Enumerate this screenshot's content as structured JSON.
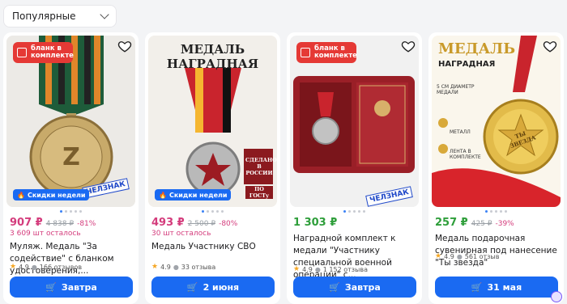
{
  "sort": {
    "label": "Популярные"
  },
  "colors": {
    "accent": "#1a6af2",
    "discount": "#d43c7c",
    "green_price": "#2e9e3a"
  },
  "products": [
    {
      "badge": "бланк в комплекте",
      "week_tag": "Скидки недели",
      "stamp": "ЧЕЛЗНАК",
      "price": "907 ₽",
      "old_price": "4 838 ₽",
      "discount": "-81%",
      "stock": "3 609 шт осталось",
      "title": "Муляж. Медаль \"За содействие\" с бланком удостоверения,...",
      "rating": "4.9",
      "reviews": "166 отзывов",
      "delivery": "Завтра"
    },
    {
      "image_title": "МЕДАЛЬ НАГРАДНАЯ",
      "image_caption": "СДЕЛАНО В РОССИИ",
      "image_caption2": "ПО ГОСТу",
      "week_tag": "Скидки недели",
      "price": "493 ₽",
      "old_price": "2 500 ₽",
      "discount": "-80%",
      "stock": "30 шт осталось",
      "title": "Медаль Участнику СВО",
      "rating": "4.9",
      "reviews": "33 отзыва",
      "delivery": "2 июня"
    },
    {
      "badge": "бланк в комплекте",
      "stamp": "ЧЕЛЗНАК",
      "price": "1 303 ₽",
      "title": "Наградной комплект к медали \"Участнику специальной военной операции\" с...",
      "rating": "4.9",
      "reviews": "1 152 отзыва",
      "delivery": "Завтра"
    },
    {
      "image_title": "МЕДАЛЬ",
      "image_subtitle": "НАГРАДНАЯ",
      "image_feature1": "5 СМ ДИАМЕТР МЕДАЛИ",
      "image_feature2": "МЕТАЛЛ",
      "image_feature3": "ЛЕНТА В КОМПЛЕКТЕ",
      "image_medal_text": "ТЫ ЗВЕЗДА",
      "price": "257 ₽",
      "old_price": "425 ₽",
      "discount": "-39%",
      "title": "Медаль подарочная сувенирная под нанесение \"Ты звезда\"",
      "rating": "4.9",
      "reviews": "561 отзыв",
      "delivery": "31 мая"
    }
  ]
}
